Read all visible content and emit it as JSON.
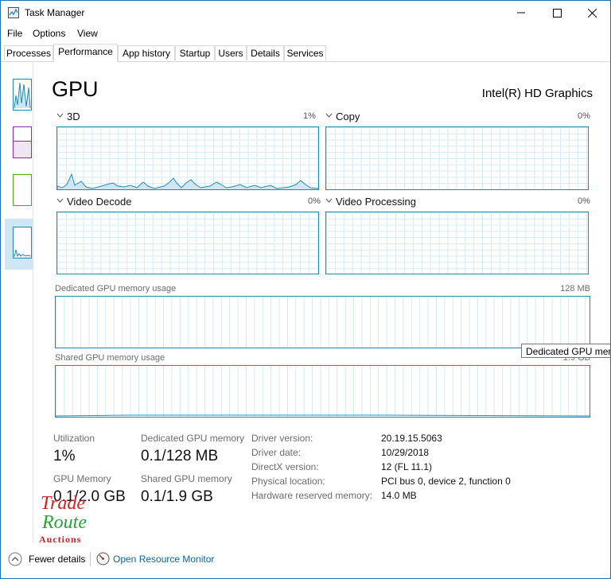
{
  "window": {
    "title": "Task Manager"
  },
  "menu": [
    "File",
    "Options",
    "View"
  ],
  "tabs": [
    "Processes",
    "Performance",
    "App history",
    "Startup",
    "Users",
    "Details",
    "Services"
  ],
  "active_tab": "Performance",
  "header": {
    "title": "GPU",
    "adapter": "Intel(R) HD Graphics"
  },
  "engines": [
    {
      "label": "3D",
      "percent": "1%"
    },
    {
      "label": "Copy",
      "percent": "0%"
    },
    {
      "label": "Video Decode",
      "percent": "0%"
    },
    {
      "label": "Video Processing",
      "percent": "0%"
    }
  ],
  "dedicated_mem": {
    "label": "Dedicated GPU memory usage",
    "max": "128 MB"
  },
  "shared_mem": {
    "label": "Shared GPU memory usage",
    "max": "1.9 GB"
  },
  "tooltip": "Dedicated GPU memory",
  "stats": {
    "utilization_label": "Utilization",
    "utilization": "1%",
    "dedicated_label": "Dedicated GPU memory",
    "dedicated": "0.1/128 MB",
    "gpu_memory_label": "GPU Memory",
    "gpu_memory": "0.1/2.0 GB",
    "shared_label": "Shared GPU memory",
    "shared": "0.1/1.9 GB"
  },
  "info": [
    {
      "label": "Driver version:",
      "value": "20.19.15.5063"
    },
    {
      "label": "Driver date:",
      "value": "10/29/2018"
    },
    {
      "label": "DirectX version:",
      "value": "12 (FL 11.1)"
    },
    {
      "label": "Physical location:",
      "value": "PCI bus 0, device 2, function 0"
    },
    {
      "label": "Hardware reserved memory:",
      "value": "14.0 MB"
    }
  ],
  "watermark": {
    "line1": "Trade",
    "line2": "Route",
    "line3": "Auctions"
  },
  "footer": {
    "fewer_details": "Fewer details",
    "open_monitor": "Open Resource Monitor"
  },
  "colors": {
    "accent": "#1f8ab0",
    "gpu_line": "#1e8fbf",
    "window_border": "#1f6fb2"
  }
}
